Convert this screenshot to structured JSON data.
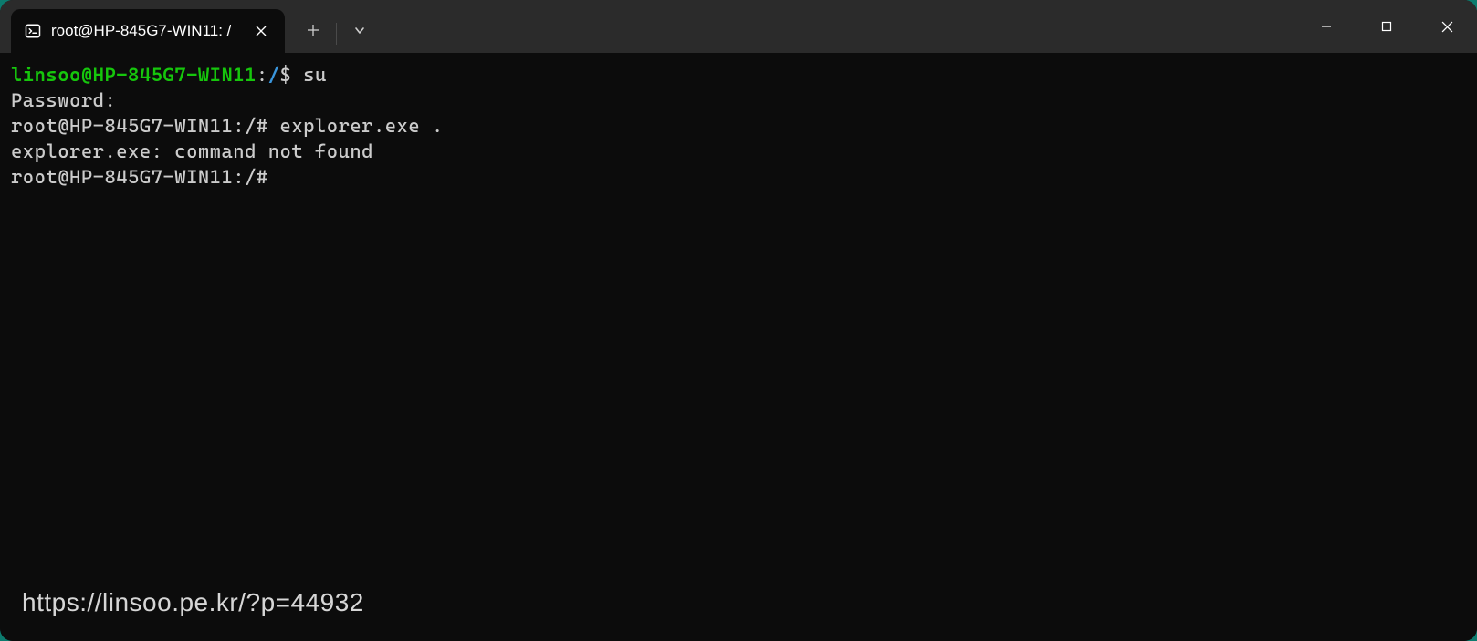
{
  "tab": {
    "title": "root@HP-845G7-WIN11: /"
  },
  "terminal": {
    "lines": [
      {
        "user": "linsoo@HP-845G7-WIN11",
        "sep": ":",
        "path": "/",
        "promptChar": "$",
        "cmd": " su"
      },
      {
        "plain": "Password:"
      },
      {
        "plain": "root@HP-845G7-WIN11:/# explorer.exe ."
      },
      {
        "plain": "explorer.exe: command not found"
      },
      {
        "plain": "root@HP-845G7-WIN11:/#"
      }
    ]
  },
  "watermark": "https://linsoo.pe.kr/?p=44932"
}
